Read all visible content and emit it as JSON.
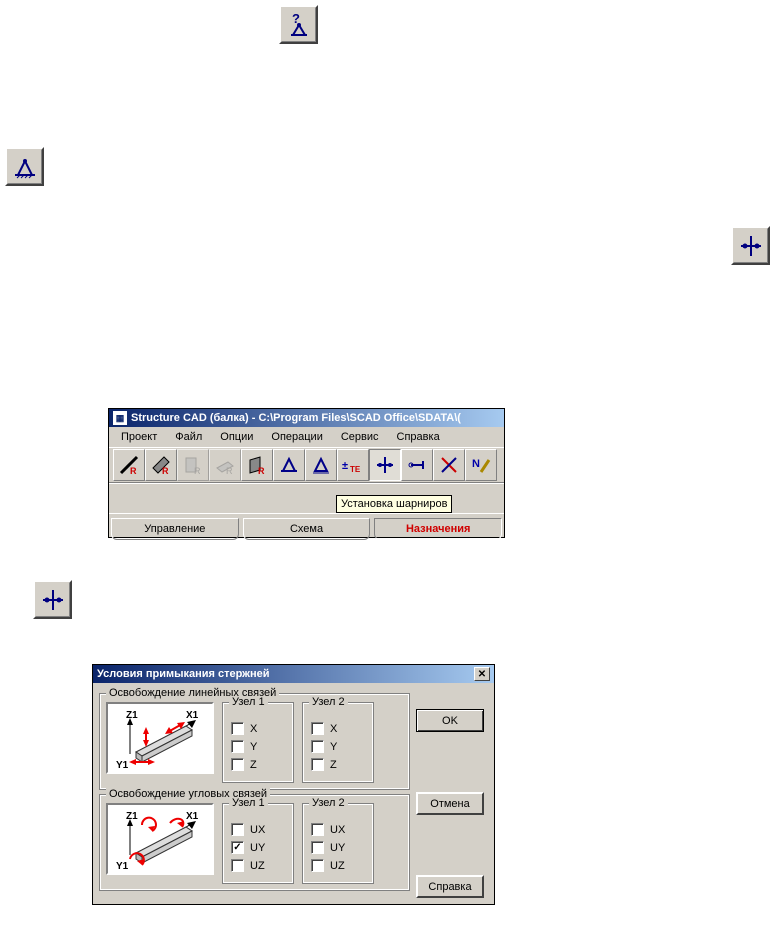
{
  "icons": {
    "question_support": "?",
    "support": "support",
    "hinge": "hinge"
  },
  "window": {
    "title": "Structure CAD (балка) - C:\\Program Files\\SCAD Office\\SDATA\\(",
    "menu": [
      "Проект",
      "Файл",
      "Опции",
      "Операции",
      "Сервис",
      "Справка"
    ],
    "tooltip": "Установка шарниров",
    "tabs": {
      "manage": "Управление",
      "scheme": "Схема",
      "assign": "Назначения"
    }
  },
  "dialog": {
    "title": "Условия примыкания стержней",
    "group_linear": "Освобождение линейных связей",
    "group_angular": "Освобождение угловых связей",
    "node1": "Узел 1",
    "node2": "Узел 2",
    "linear": {
      "x": "X",
      "y": "Y",
      "z": "Z"
    },
    "angular": {
      "ux": "UX",
      "uy": "UY",
      "uz": "UZ"
    },
    "buttons": {
      "ok": "OK",
      "cancel": "Отмена",
      "help": "Справка"
    }
  }
}
